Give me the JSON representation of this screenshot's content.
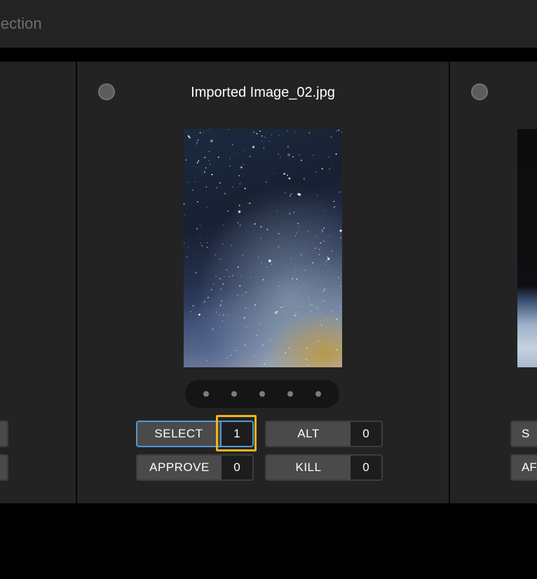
{
  "topbar": {
    "title": "lection"
  },
  "center_card": {
    "filename": "Imported Image_02.jpg",
    "image_icon": "milky-way-photo",
    "pager_dots": 5,
    "buttons": {
      "select": {
        "label": "SELECT",
        "count": "1"
      },
      "alt": {
        "label": "ALT",
        "count": "0"
      },
      "approve": {
        "label": "APPROVE",
        "count": "0"
      },
      "kill": {
        "label": "KILL",
        "count": "0"
      }
    }
  },
  "right_card": {
    "button_top_label": "S",
    "button_bottom_label": "AF"
  },
  "colors": {
    "panel": "#232323",
    "button": "#4a4a4a",
    "count_bg": "#1d1d1d",
    "select_accent": "#4f9ad6",
    "focus": "#f2b61b"
  }
}
